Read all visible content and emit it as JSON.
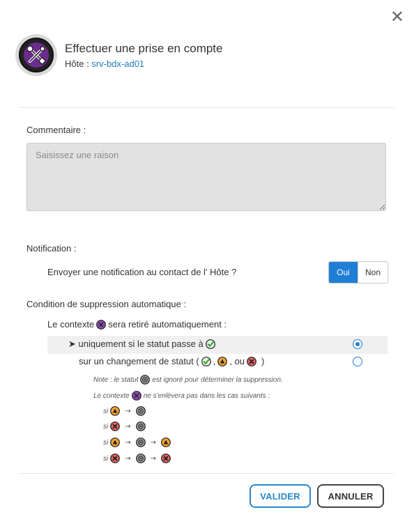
{
  "dialog": {
    "title": "Effectuer une prise en compte",
    "host_label": "Hôte : ",
    "host_name": "srv-bdx-ad01",
    "close_glyph": "✕"
  },
  "comment": {
    "label": "Commentaire :",
    "placeholder": "Saisissez une raison",
    "value": ""
  },
  "notification": {
    "label": "Notification :",
    "question": "Envoyer une notification au contact de l' Hôte ?",
    "options": [
      "Oui",
      "Non"
    ],
    "selected": "Oui"
  },
  "auto_removal": {
    "label": "Condition de suppression automatique :",
    "context_prefix": "Le contexte",
    "context_suffix": "sera retiré automatiquement :",
    "option1_prefix": "➤ uniquement si le statut passe à",
    "option2_prefix": "sur un changement de statut (",
    "option2_sep1": ",",
    "option2_sep2": ", ou",
    "option2_suffix": ")",
    "selected_option": 1,
    "note1_prefix": "Note : le statut",
    "note1_suffix": "est ignoré pour déterminer la suppression.",
    "note2_prefix": "Le contexte",
    "note2_suffix": "ne s'enlèvera pas dans les cas suivants :",
    "case_prefix": "si",
    "arrow": "→"
  },
  "buttons": {
    "validate": "VALIDER",
    "cancel": "ANNULER"
  },
  "colors": {
    "accent": "#1f7ed6",
    "ok_green": "#3fa33f",
    "warning_orange": "#f0a030",
    "critical_red": "#d94040",
    "context_purple": "#7b3fa0",
    "unknown_grey": "#8a8a8a"
  }
}
